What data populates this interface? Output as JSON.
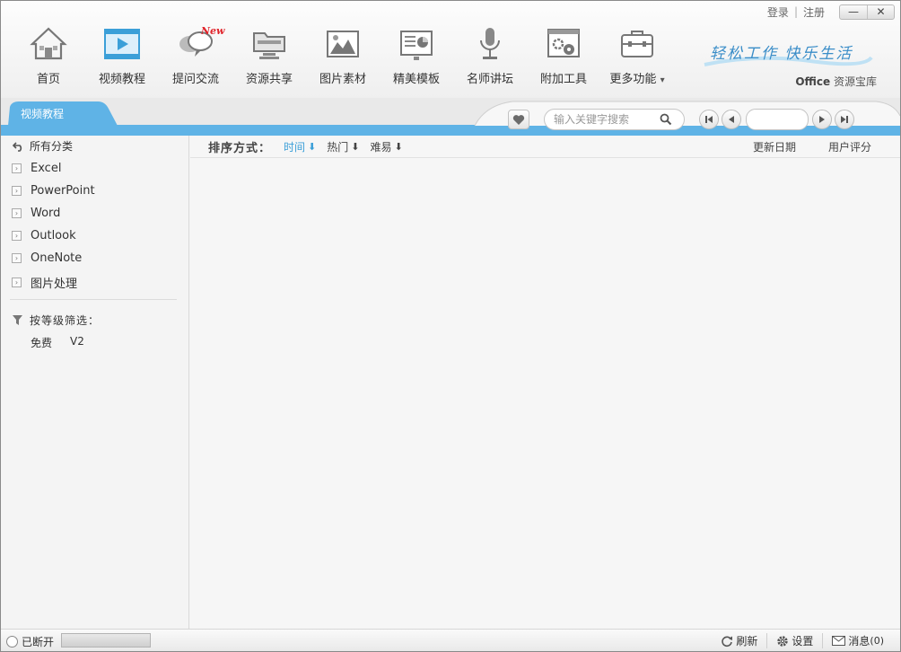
{
  "topbar": {
    "login": "登录",
    "separator": "|",
    "register": "注册",
    "minimize": "—",
    "close": "✕"
  },
  "nav": {
    "items": [
      {
        "label": "首页",
        "icon": "home-icon"
      },
      {
        "label": "视频教程",
        "icon": "video-icon"
      },
      {
        "label": "提问交流",
        "icon": "chat-icon",
        "badge": "New"
      },
      {
        "label": "资源共享",
        "icon": "folder-icon"
      },
      {
        "label": "图片素材",
        "icon": "picture-icon"
      },
      {
        "label": "精美模板",
        "icon": "template-icon"
      },
      {
        "label": "名师讲坛",
        "icon": "microphone-icon"
      },
      {
        "label": "附加工具",
        "icon": "tools-icon"
      },
      {
        "label": "更多功能",
        "icon": "toolbox-icon",
        "dropdown": "▾"
      }
    ]
  },
  "brand": {
    "slogan": "轻松工作 快乐生活",
    "name_bold": "Office",
    "name_rest": " 资源宝库"
  },
  "tabs": {
    "active": "视频教程"
  },
  "search": {
    "placeholder": "输入关键字搜索",
    "value": ""
  },
  "pager": {
    "page_value": ""
  },
  "sidebar": {
    "all": "所有分类",
    "categories": [
      "Excel",
      "PowerPoint",
      "Word",
      "Outlook",
      "OneNote",
      "图片处理"
    ],
    "filter_label": "按等级筛选：",
    "levels": [
      "免费",
      "V2"
    ]
  },
  "sortbar": {
    "label": "排序方式：",
    "options": [
      "时间",
      "热门",
      "难易"
    ],
    "columns": [
      "更新日期",
      "用户评分"
    ]
  },
  "status": {
    "connection": "已断开",
    "progress": 0,
    "refresh": "刷新",
    "settings": "设置",
    "messages_label": "消息",
    "messages_count": "(0)"
  },
  "colors": {
    "accent": "#5fb3e6",
    "active_sort": "#3b9fd8",
    "new_badge": "#e0232a"
  }
}
